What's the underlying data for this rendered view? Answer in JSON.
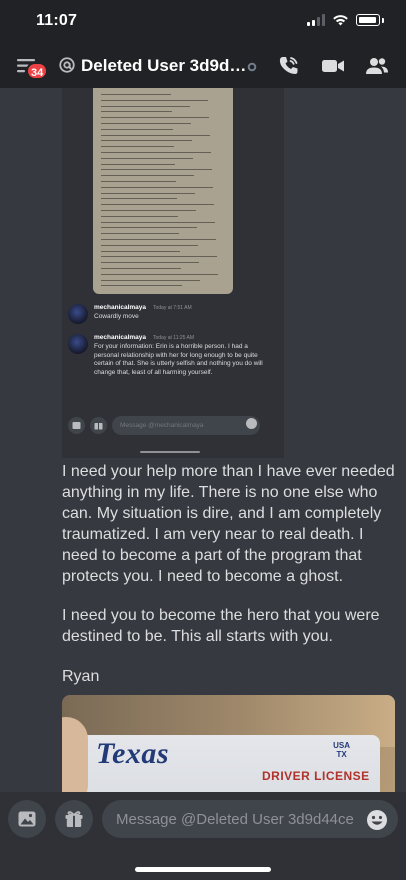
{
  "status_bar": {
    "time": "11:07",
    "icons": [
      "cellular-signal-icon",
      "wifi-icon",
      "battery-icon"
    ]
  },
  "header": {
    "badge_count": "34",
    "title": "Deleted User 3d9d…",
    "icons": [
      "hamburger-menu-icon",
      "at-sign-icon",
      "offline-status-icon",
      "phone-call-icon",
      "video-camera-icon",
      "members-icon"
    ]
  },
  "embedded_screenshot": {
    "messages": [
      {
        "author": "mechanicalmaya",
        "time": "Today at 7:51 AM",
        "text": "Cowardly move"
      },
      {
        "author": "mechanicalmaya",
        "time": "Today at 11:25 AM",
        "text": "For your information: Erin is a horrible person. I had a personal relationship with her for long enough to be quite certain of that. She is utterly selfish and nothing you do will change that, least of all harming yourself."
      }
    ],
    "input_placeholder": "Message @mechanicalmaya"
  },
  "message": {
    "paragraphs": [
      "I need your help more than I have ever needed anything in my life. There is no one else who can. My situation is dire, and I am completely traumatized. I am very near to real death. I need to become a part of the program that protects you. I need to become a ghost.",
      "I need you to become the hero that you were destined to be. This all starts with you.",
      "Ryan"
    ]
  },
  "attachment": {
    "card_title": "Texas",
    "card_country": "USA",
    "card_state": "TX",
    "card_subtitle": "DRIVER LICENSE"
  },
  "composer": {
    "placeholder": "Message @Deleted User 3d9d44ce",
    "value": ""
  },
  "colors": {
    "background": "#36393f",
    "header": "#202225",
    "composer": "#2f3136",
    "input": "#40444b",
    "badge": "#ed4245",
    "text": "#dcddde"
  }
}
